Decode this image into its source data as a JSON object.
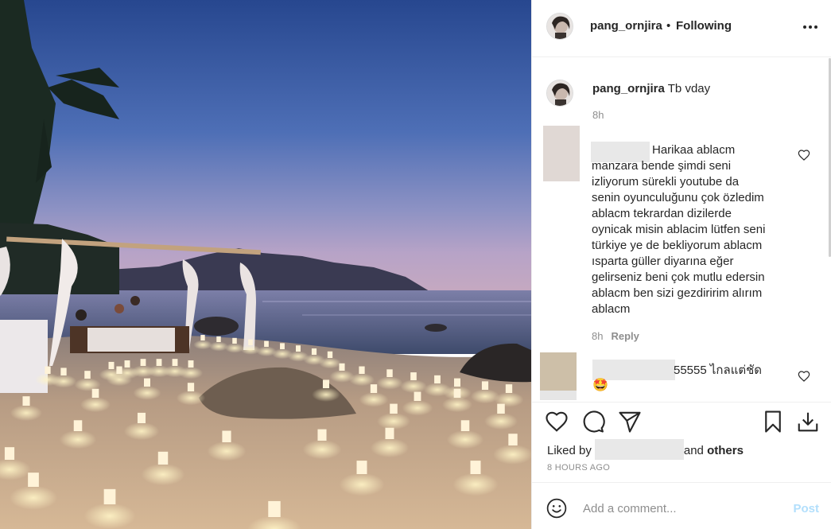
{
  "post": {
    "username": "pang_ornjira",
    "separator": "•",
    "follow_status": "Following",
    "more_icon": "more-horizontal-icon"
  },
  "caption": {
    "username": "pang_ornjira",
    "text": "Tb vday",
    "time": "8h"
  },
  "comments": [
    {
      "text": "Harikaa ablacm\nmanzara bende şimdi seni\nizliyorum sürekli youtube da\nsenin oyunculuğunu çok özledim\nablacm tekrardan dizilerde\noynicak misin ablacim lütfen seni\ntürkiye ye de bekliyorum ablacm\nısparta güller diyarına eğer\ngelirseniz beni çok mutlu edersin\nablacm ben sizi gezdiririm alırım\nablacm",
      "time": "8h",
      "reply_label": "Reply",
      "avatar_color": "#e0d8d4"
    },
    {
      "text": "55555 ไกลแต่ชัด",
      "emoji": "🤩",
      "avatar_color": "#cdbfa8"
    }
  ],
  "actions": {
    "liked_prefix": "Liked by",
    "liked_suffix_and": "and",
    "liked_others": "others",
    "time_ago": "8 HOURS AGO"
  },
  "composer": {
    "placeholder": "Add a comment...",
    "post_label": "Post"
  },
  "colors": {
    "sky_top": "#2f4f9c",
    "sky_horizon": "#b4a1c8",
    "link_disabled": "#b2dffc",
    "muted": "#8e8e8e"
  }
}
